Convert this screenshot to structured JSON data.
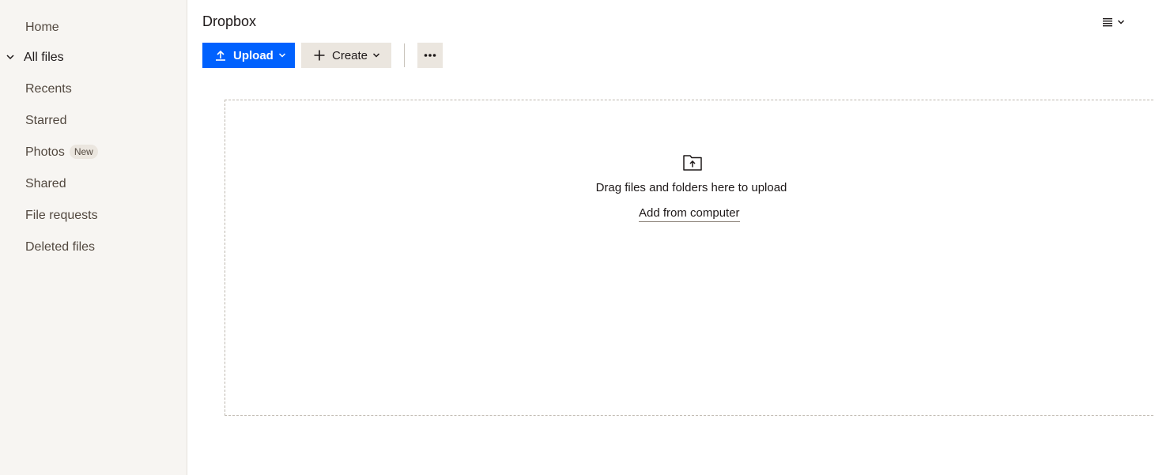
{
  "sidebar": {
    "items": [
      {
        "label": "Home"
      },
      {
        "label": "All files"
      },
      {
        "label": "Recents"
      },
      {
        "label": "Starred"
      },
      {
        "label": "Photos",
        "badge": "New"
      },
      {
        "label": "Shared"
      },
      {
        "label": "File requests"
      },
      {
        "label": "Deleted files"
      }
    ]
  },
  "header": {
    "title": "Dropbox",
    "view_toggle_icon": "list-view-icon"
  },
  "toolbar": {
    "upload_label": "Upload",
    "create_label": "Create",
    "more_icon": "more-horizontal-icon"
  },
  "dropzone": {
    "message": "Drag files and folders here to upload",
    "link": "Add from computer",
    "icon": "folder-upload-icon"
  },
  "colors": {
    "accent": "#0061fe",
    "sidebar_bg": "#f7f5f2",
    "secondary_button_bg": "#ebe6df"
  }
}
